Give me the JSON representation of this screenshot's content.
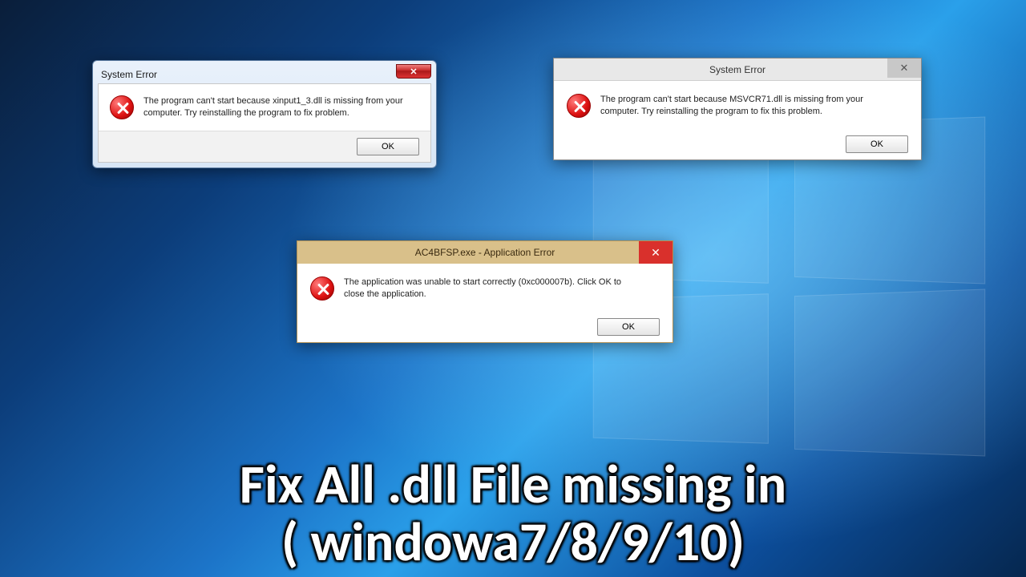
{
  "dialog1": {
    "title": "System Error",
    "message": "The program can't start because xinput1_3.dll is missing from your computer. Try reinstalling the program to fix problem.",
    "ok": "OK"
  },
  "dialog2": {
    "title": "System Error",
    "message": "The program can't start because MSVCR71.dll is missing from your computer. Try reinstalling the program to fix this problem.",
    "ok": "OK"
  },
  "dialog3": {
    "title": "AC4BFSP.exe - Application Error",
    "message": "The application was unable to start correctly (0xc000007b). Click OK to close the application.",
    "ok": "OK"
  },
  "headline": {
    "line1": "Fix All .dll File missing  in",
    "line2": "( windowa7/8/9/10)"
  }
}
